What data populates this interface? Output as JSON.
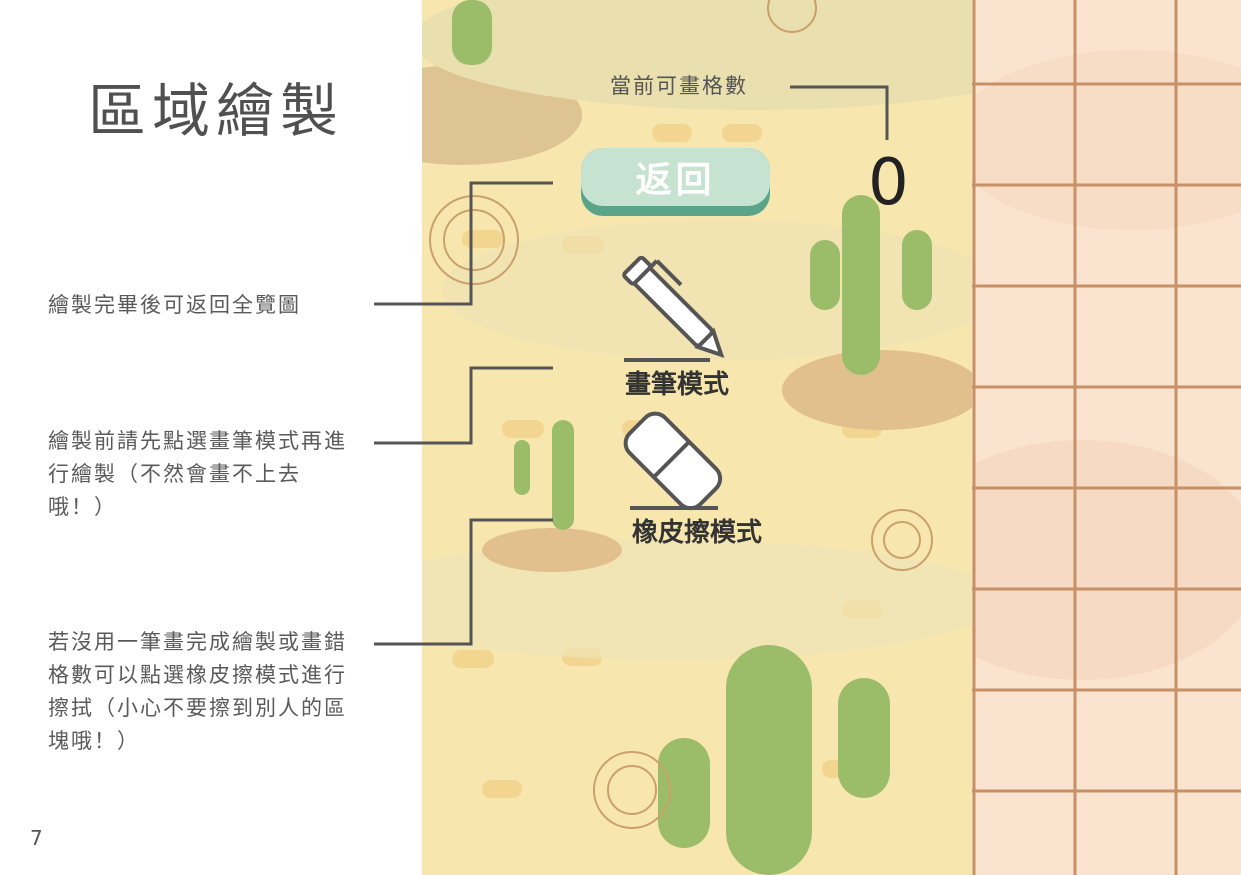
{
  "page": {
    "title": "區域繪製",
    "page_number": "7"
  },
  "annotations": {
    "back": "繪製完畢後可返回全覽圖",
    "pen": "繪製前請先點選畫筆模式再進行繪製（不然會畫不上去哦！）",
    "eraser": "若沒用一筆畫完成繪製或畫錯格數可以點選橡皮擦模式進行擦拭（小心不要擦到別人的區塊哦！）"
  },
  "game": {
    "count_label": "當前可畫格數",
    "count_value": "0",
    "back_button": "返回",
    "pen_mode": "畫筆模式",
    "eraser_mode": "橡皮擦模式",
    "icons": [
      "pen-icon",
      "eraser-icon"
    ]
  },
  "colors": {
    "sand": "#f7e6ad",
    "cactus": "#8fb260",
    "button_top": "#c6e2d0",
    "button_base": "#5aa58a",
    "grid_fill": "#fae3cf",
    "grid_line": "#c79067",
    "leader_line": "#555555"
  }
}
